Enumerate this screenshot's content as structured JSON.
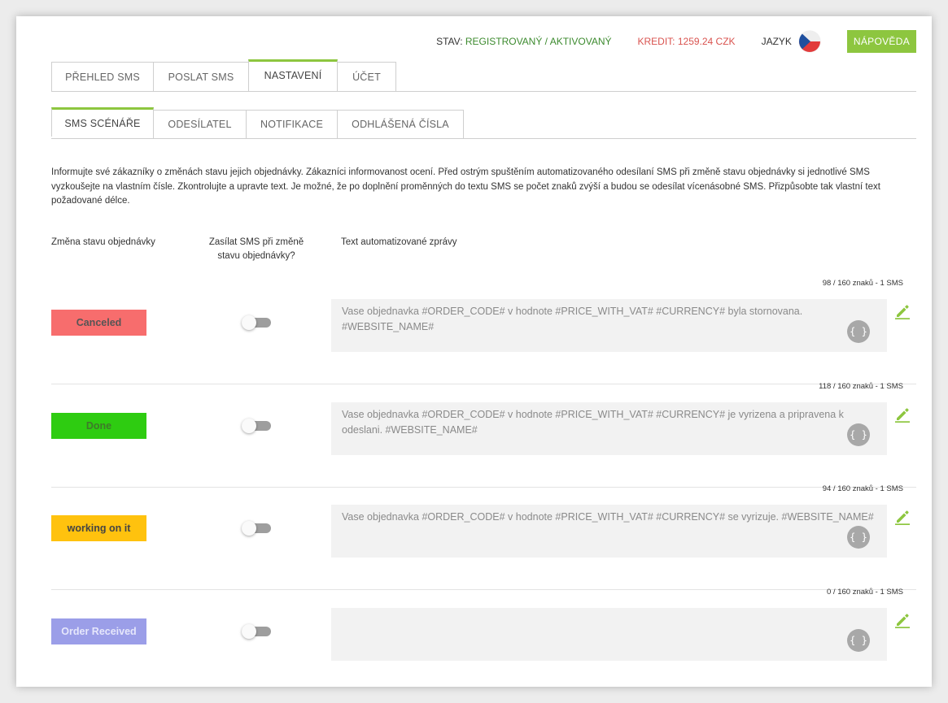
{
  "header": {
    "status_label": "STAV: ",
    "status_value": "REGISTROVANÝ / AKTIVOVANÝ",
    "credit": "KREDIT: 1259.24 CZK",
    "language_label": "JAZYK",
    "help_button": "NÁPOVĚDA"
  },
  "main_tabs": [
    {
      "label": "PŘEHLED SMS"
    },
    {
      "label": "POSLAT SMS"
    },
    {
      "label": "NASTAVENÍ"
    },
    {
      "label": "ÚČET"
    }
  ],
  "sub_tabs": [
    {
      "label": "SMS SCÉNÁŘE"
    },
    {
      "label": "ODESÍLATEL"
    },
    {
      "label": "NOTIFIKACE"
    },
    {
      "label": "ODHLÁŠENÁ ČÍSLA"
    }
  ],
  "intro": "Informujte své zákazníky o změnách stavu jejich objednávky. Zákazníci informovanost ocení. Před ostrým spuštěním automatizovaného odesílaní SMS při změně stavu objednávky si jednotlivé SMS vyzkoušejte na vlastním čísle. Zkontrolujte a upravte text. Je možné, že po doplnění proměnných do textu SMS se počet znaků zvýší a budou se odesílat vícenásobné SMS. Přizpůsobte tak vlastní text požadované délce.",
  "columns": {
    "status": "Změna stavu objednávky",
    "send": "Zasílat SMS při změně stavu objednávky?",
    "text": "Text automatizované zprávy"
  },
  "var_button": "{ }",
  "rows": [
    {
      "status": "Canceled",
      "color": "#f76d6d",
      "text_color": "#555555",
      "count": "98 / 160 znaků - 1 SMS",
      "enabled": false,
      "text": "Vase objednavka #ORDER_CODE# v hodnote #PRICE_WITH_VAT# #CURRENCY# byla stornovana. #WEBSITE_NAME#"
    },
    {
      "status": "Done",
      "color": "#2ecc11",
      "text_color": "#3e7a2a",
      "count": "118 / 160 znaků - 1 SMS",
      "enabled": false,
      "text": "Vase objednavka #ORDER_CODE# v hodnote #PRICE_WITH_VAT# #CURRENCY# je vyrizena a pripravena k odeslani. #WEBSITE_NAME#"
    },
    {
      "status": "working on it",
      "color": "#ffc20e",
      "text_color": "#444444",
      "count": "94 / 160 znaků - 1 SMS",
      "enabled": false,
      "text": "Vase objednavka #ORDER_CODE# v hodnote #PRICE_WITH_VAT# #CURRENCY# se vyrizuje. #WEBSITE_NAME#"
    },
    {
      "status": "Order Received",
      "color": "#9b9ee8",
      "text_color": "#e6e7fb",
      "count": "0 / 160 znaků - 1 SMS",
      "enabled": false,
      "text": ""
    }
  ],
  "colors": {
    "accent": "#8dc63f",
    "status_ok": "#3c8a2e",
    "credit": "#d9534f"
  }
}
